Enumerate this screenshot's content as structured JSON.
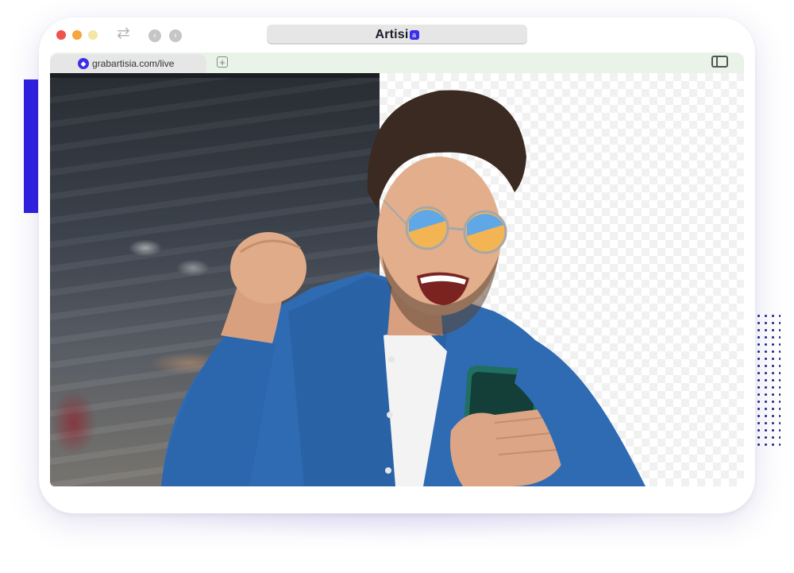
{
  "browser": {
    "brand_name": "Artisi",
    "brand_mark": "a",
    "tab_title": "grabartisia.com/live",
    "tab_icon": "artisia-logo-icon"
  },
  "icons": {
    "refresh": "refresh-icon",
    "back": "back-arrow-icon",
    "forward": "forward-arrow-icon",
    "new_tab": "new-tab-icon",
    "sidebar": "sidebar-toggle-icon"
  },
  "colors": {
    "accent": "#2d1ee0",
    "brand": "#3a2ee8",
    "tabbar": "#e9f3e8"
  },
  "glyphs": {
    "refresh": "⇄",
    "back": "‹",
    "forward": "›",
    "new_tab": "+"
  }
}
